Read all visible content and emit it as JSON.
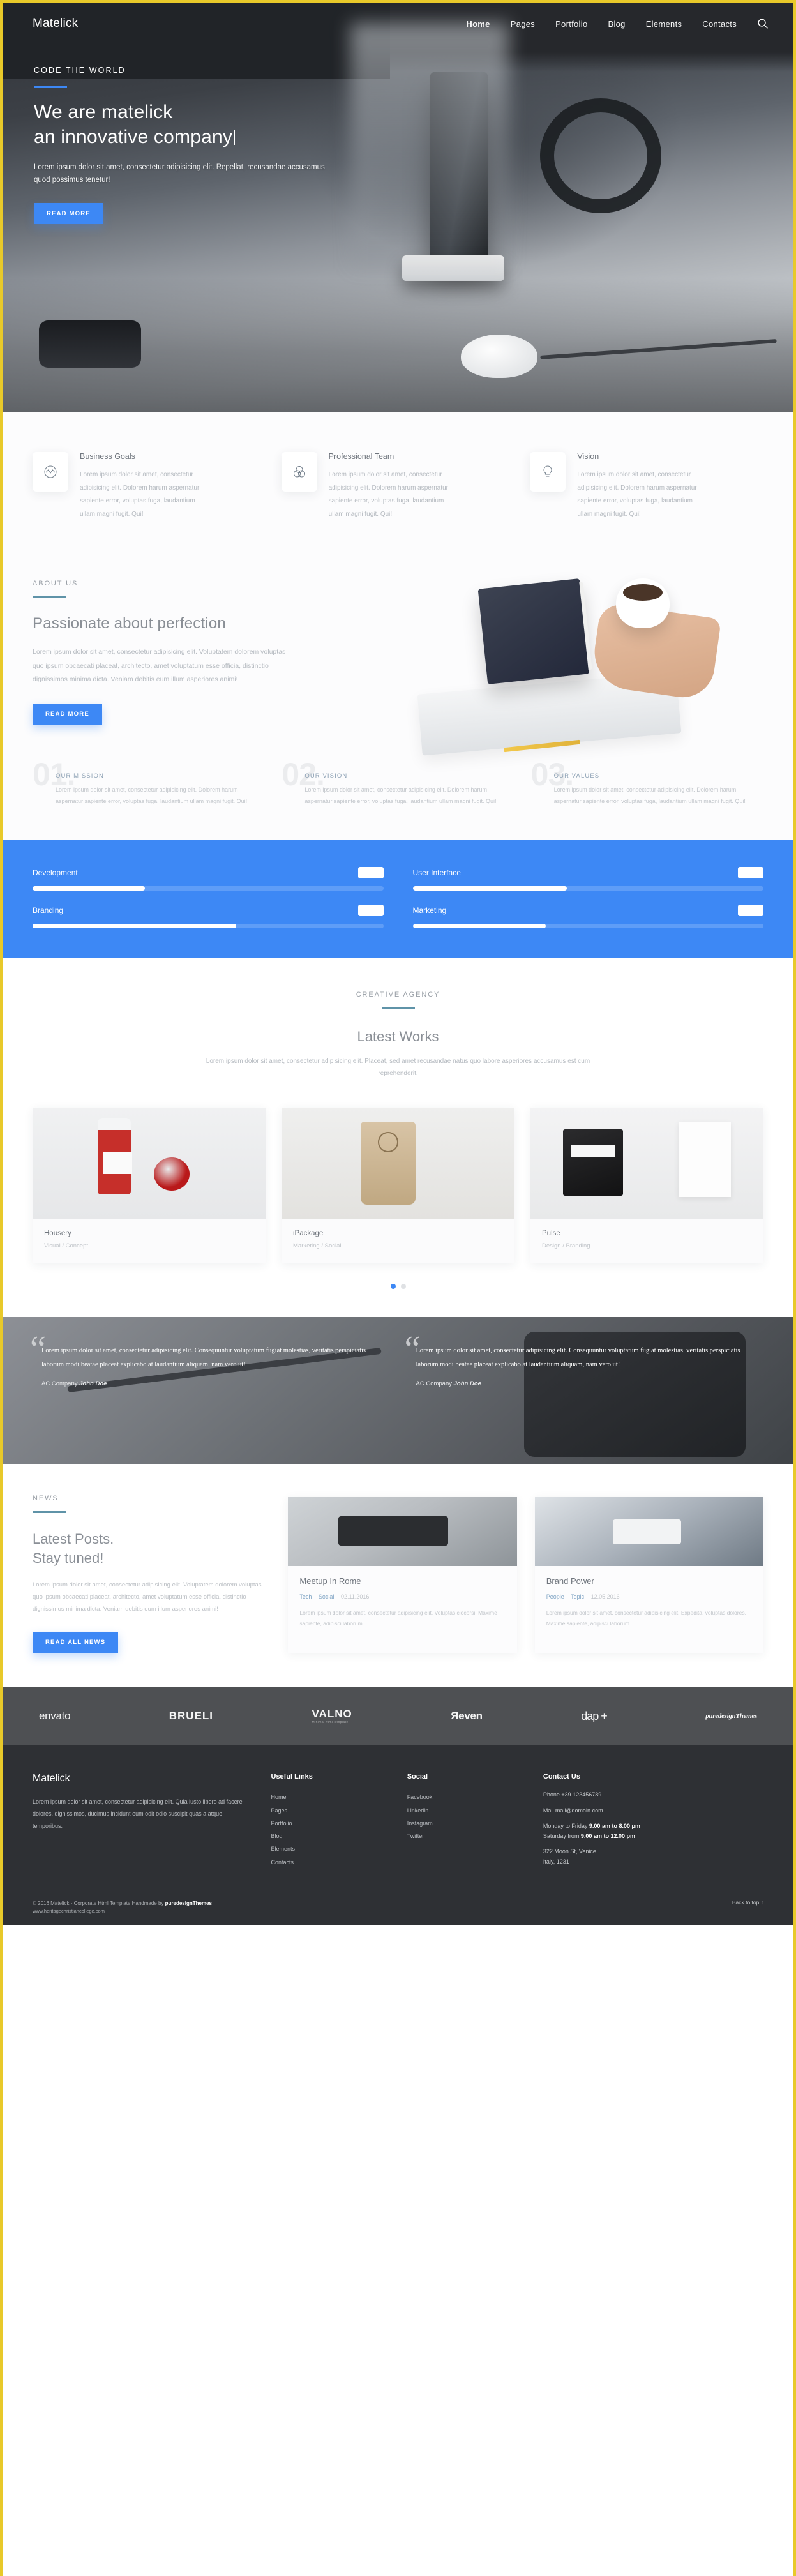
{
  "brand": {
    "name": "Matelick",
    "accent": "#3d88f5",
    "frame_color": "#e8c92a"
  },
  "nav": {
    "items": [
      "Home",
      "Pages",
      "Portfolio",
      "Blog",
      "Elements",
      "Contacts"
    ],
    "search_icon": "search-icon"
  },
  "hero": {
    "eyebrow": "CODE THE WORLD",
    "title_line1": "We are matelick",
    "title_line2": "an innovative company",
    "subtitle": "Lorem ipsum dolor sit amet, consectetur adipisicing elit. Repellat, recusandae accusamus quod possimus tenetur!",
    "cta": "READ MORE"
  },
  "features": [
    {
      "icon": "wave-circle-icon",
      "title": "Business Goals",
      "text": "Lorem ipsum dolor sit amet, consectetur adipisicing elit. Dolorem harum aspernatur sapiente error, voluptas fuga, laudantium ullam magni fugit. Qui!"
    },
    {
      "icon": "venn-circles-icon",
      "title": "Professional Team",
      "text": "Lorem ipsum dolor sit amet, consectetur adipisicing elit. Dolorem harum aspernatur sapiente error, voluptas fuga, laudantium ullam magni fugit. Qui!"
    },
    {
      "icon": "lightbulb-icon",
      "title": "Vision",
      "text": "Lorem ipsum dolor sit amet, consectetur adipisicing elit. Dolorem harum aspernatur sapiente error, voluptas fuga, laudantium ullam magni fugit. Qui!"
    }
  ],
  "about": {
    "eyebrow": "ABOUT US",
    "heading": "Passionate about perfection",
    "text": "Lorem ipsum dolor sit amet, consectetur adipisicing elit. Voluptatem dolorem voluptas quo ipsum obcaecati placeat, architecto, amet voluptatum esse officia, distinctio dignissimos minima dicta. Veniam debitis eum illum asperiores animi!",
    "cta": "READ MORE"
  },
  "pillars": [
    {
      "number": "01.",
      "title": "OUR MISSION",
      "text": "Lorem ipsum dolor sit amet, consectetur adipisicing elit. Dolorem harum aspernatur sapiente error, voluptas fuga, laudantium ullam magni fugit. Qui!"
    },
    {
      "number": "02.",
      "title": "OUR VISION",
      "text": "Lorem ipsum dolor sit amet, consectetur adipisicing elit. Dolorem harum aspernatur sapiente error, voluptas fuga, laudantium ullam magni fugit. Qui!"
    },
    {
      "number": "03.",
      "title": "OUR VALUES",
      "text": "Lorem ipsum dolor sit amet, consectetur adipisicing elit. Dolorem harum aspernatur sapiente error, voluptas fuga, laudantium ullam magni fugit. Qui!"
    }
  ],
  "skills": [
    {
      "name": "Development",
      "badge": "",
      "fill_pct": 32
    },
    {
      "name": "User Interface",
      "badge": "",
      "fill_pct": 44
    },
    {
      "name": "Branding",
      "badge": "",
      "fill_pct": 58
    },
    {
      "name": "Marketing",
      "badge": "",
      "fill_pct": 38
    }
  ],
  "works": {
    "eyebrow": "CREATIVE AGENCY",
    "heading": "Latest Works",
    "text": "Lorem ipsum dolor sit amet, consectetur adipisicing elit. Placeat, sed amet recusandae natus quo labore asperiores accusamus est cum reprehenderit.",
    "cards": [
      {
        "title": "Housery",
        "meta": "Visual / Concept"
      },
      {
        "title": "iPackage",
        "meta": "Marketing / Social"
      },
      {
        "title": "Pulse",
        "meta": "Design / Branding"
      }
    ],
    "dots": [
      "active",
      "inactive"
    ]
  },
  "testimonials": [
    {
      "quote": "Lorem ipsum dolor sit amet, consectetur adipisicing elit. Consequuntur voluptatum fugiat molestias, veritatis perspiciatis laborum modi beatae placeat explicabo at laudantium aliquam, nam vero ut!",
      "company": "AC Company",
      "author": "John Doe"
    },
    {
      "quote": "Lorem ipsum dolor sit amet, consectetur adipisicing elit. Consequuntur voluptatum fugiat molestias, veritatis perspiciatis laborum modi beatae placeat explicabo at laudantium aliquam, nam vero ut!",
      "company": "AC Company",
      "author": "John Doe"
    }
  ],
  "news": {
    "eyebrow": "NEWS",
    "heading_line1": "Latest Posts.",
    "heading_line2": "Stay tuned!",
    "text": "Lorem ipsum dolor sit amet, consectetur adipisicing elit. Voluptatem dolorem voluptas quo ipsum obcaecati placeat, architecto, amet voluptatum esse officia, distinctio dignissimos minima dicta. Veniam debitis eum illum asperiores animi!",
    "cta": "READ ALL NEWS",
    "posts": [
      {
        "title": "Meetup In Rome",
        "tag1": "Tech",
        "tag2": "Social",
        "date": "02.11.2016",
        "text": "Lorem ipsum dolor sit amet, consectetur adipisicing elit. Voluptas ciocorsi. Maxime sapiente, adipisci laborum."
      },
      {
        "title": "Brand Power",
        "tag1": "People",
        "tag2": "Topic",
        "date": "12.05.2016",
        "text": "Lorem ipsum dolor sit amet, consectetur adipisicing elit. Expedita, voluptas dolores. Maxime sapiente, adipisci laborum."
      }
    ]
  },
  "logos": [
    "envato",
    "BRUELI",
    "VALNO",
    "Яeven",
    "dap +",
    "puredesignThemes"
  ],
  "logo_valno_sub": "Minimal html template",
  "footer": {
    "brand": "Matelick",
    "about": "Lorem ipsum dolor sit amet, consectetur adipisicing elit. Quia iusto libero ad facere dolores, dignissimos, ducimus incidunt eum odit odio suscipit quas a atque temporibus.",
    "useful_links": {
      "head": "Useful Links",
      "items": [
        "Home",
        "Pages",
        "Portfolio",
        "Blog",
        "Elements",
        "Contacts"
      ]
    },
    "social": {
      "head": "Social",
      "items": [
        "Facebook",
        "Linkedin",
        "Instagram",
        "Twitter"
      ]
    },
    "contact": {
      "head": "Contact Us",
      "phone_label": "Phone",
      "phone_value": "+39 123456789",
      "mail_label": "Mail",
      "mail_value": "mail@domain.com",
      "hours_weekday_label": "Monday to Friday",
      "hours_weekday_value": "9.00 am to 8.00 pm",
      "hours_saturday_label": "Saturday from",
      "hours_saturday_value": "9.00 am to 12.00 pm",
      "address_line1": "322 Moon St, Venice",
      "address_line2": "Italy, 1231"
    }
  },
  "copyright": {
    "text_prefix": "© 2016 Matelick - Corporate Html Template Handmade by ",
    "text_brand": "puredesignThemes",
    "url": "www.heritagechristiancollege.com",
    "back_to_top": "Back to top ↑"
  }
}
